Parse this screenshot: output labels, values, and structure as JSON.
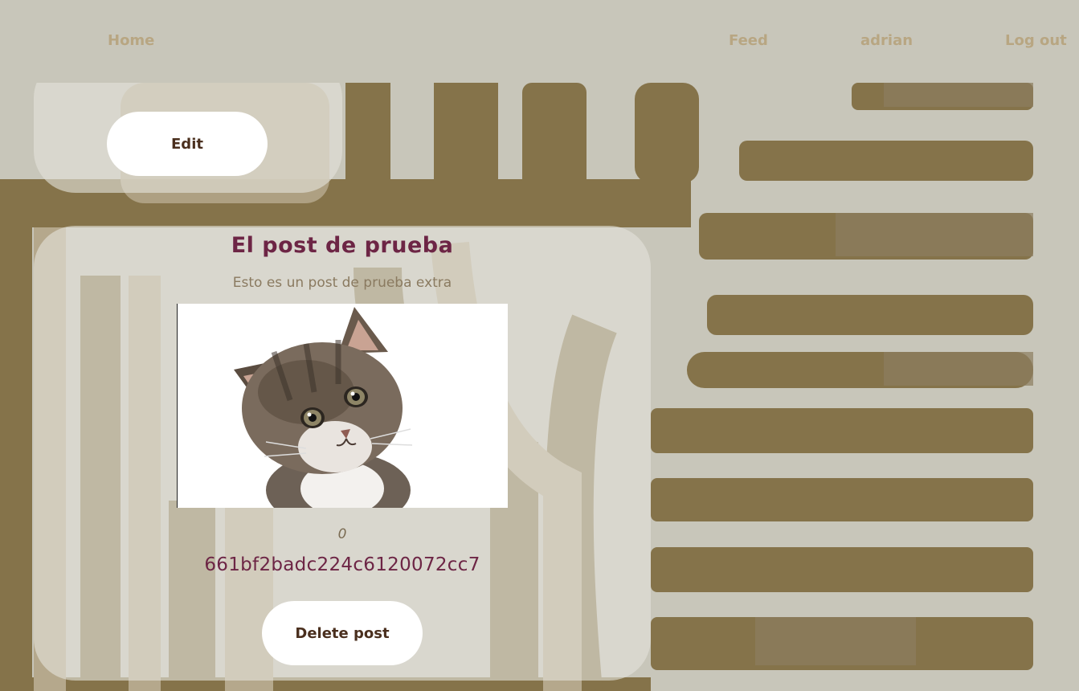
{
  "nav": {
    "home_label": "Home",
    "feed_label": "Feed",
    "user_label": "adrian",
    "logout_label": "Log out"
  },
  "edit_card": {
    "edit_label": "Edit"
  },
  "post": {
    "title": "El post de prueba",
    "description": "Esto es un post de prueba extra",
    "image_subject": "kitten-photo",
    "count": "0",
    "id": "661bf2badc224c6120072cc7",
    "delete_label": "Delete post"
  },
  "colors": {
    "background": "#c8c6ba",
    "nav_link": "#b8a682",
    "stripe_dark": "#85734a",
    "stripe_mid": "#b5a88c",
    "title_accent": "#6d2545",
    "button_text": "#4a2f1e"
  }
}
